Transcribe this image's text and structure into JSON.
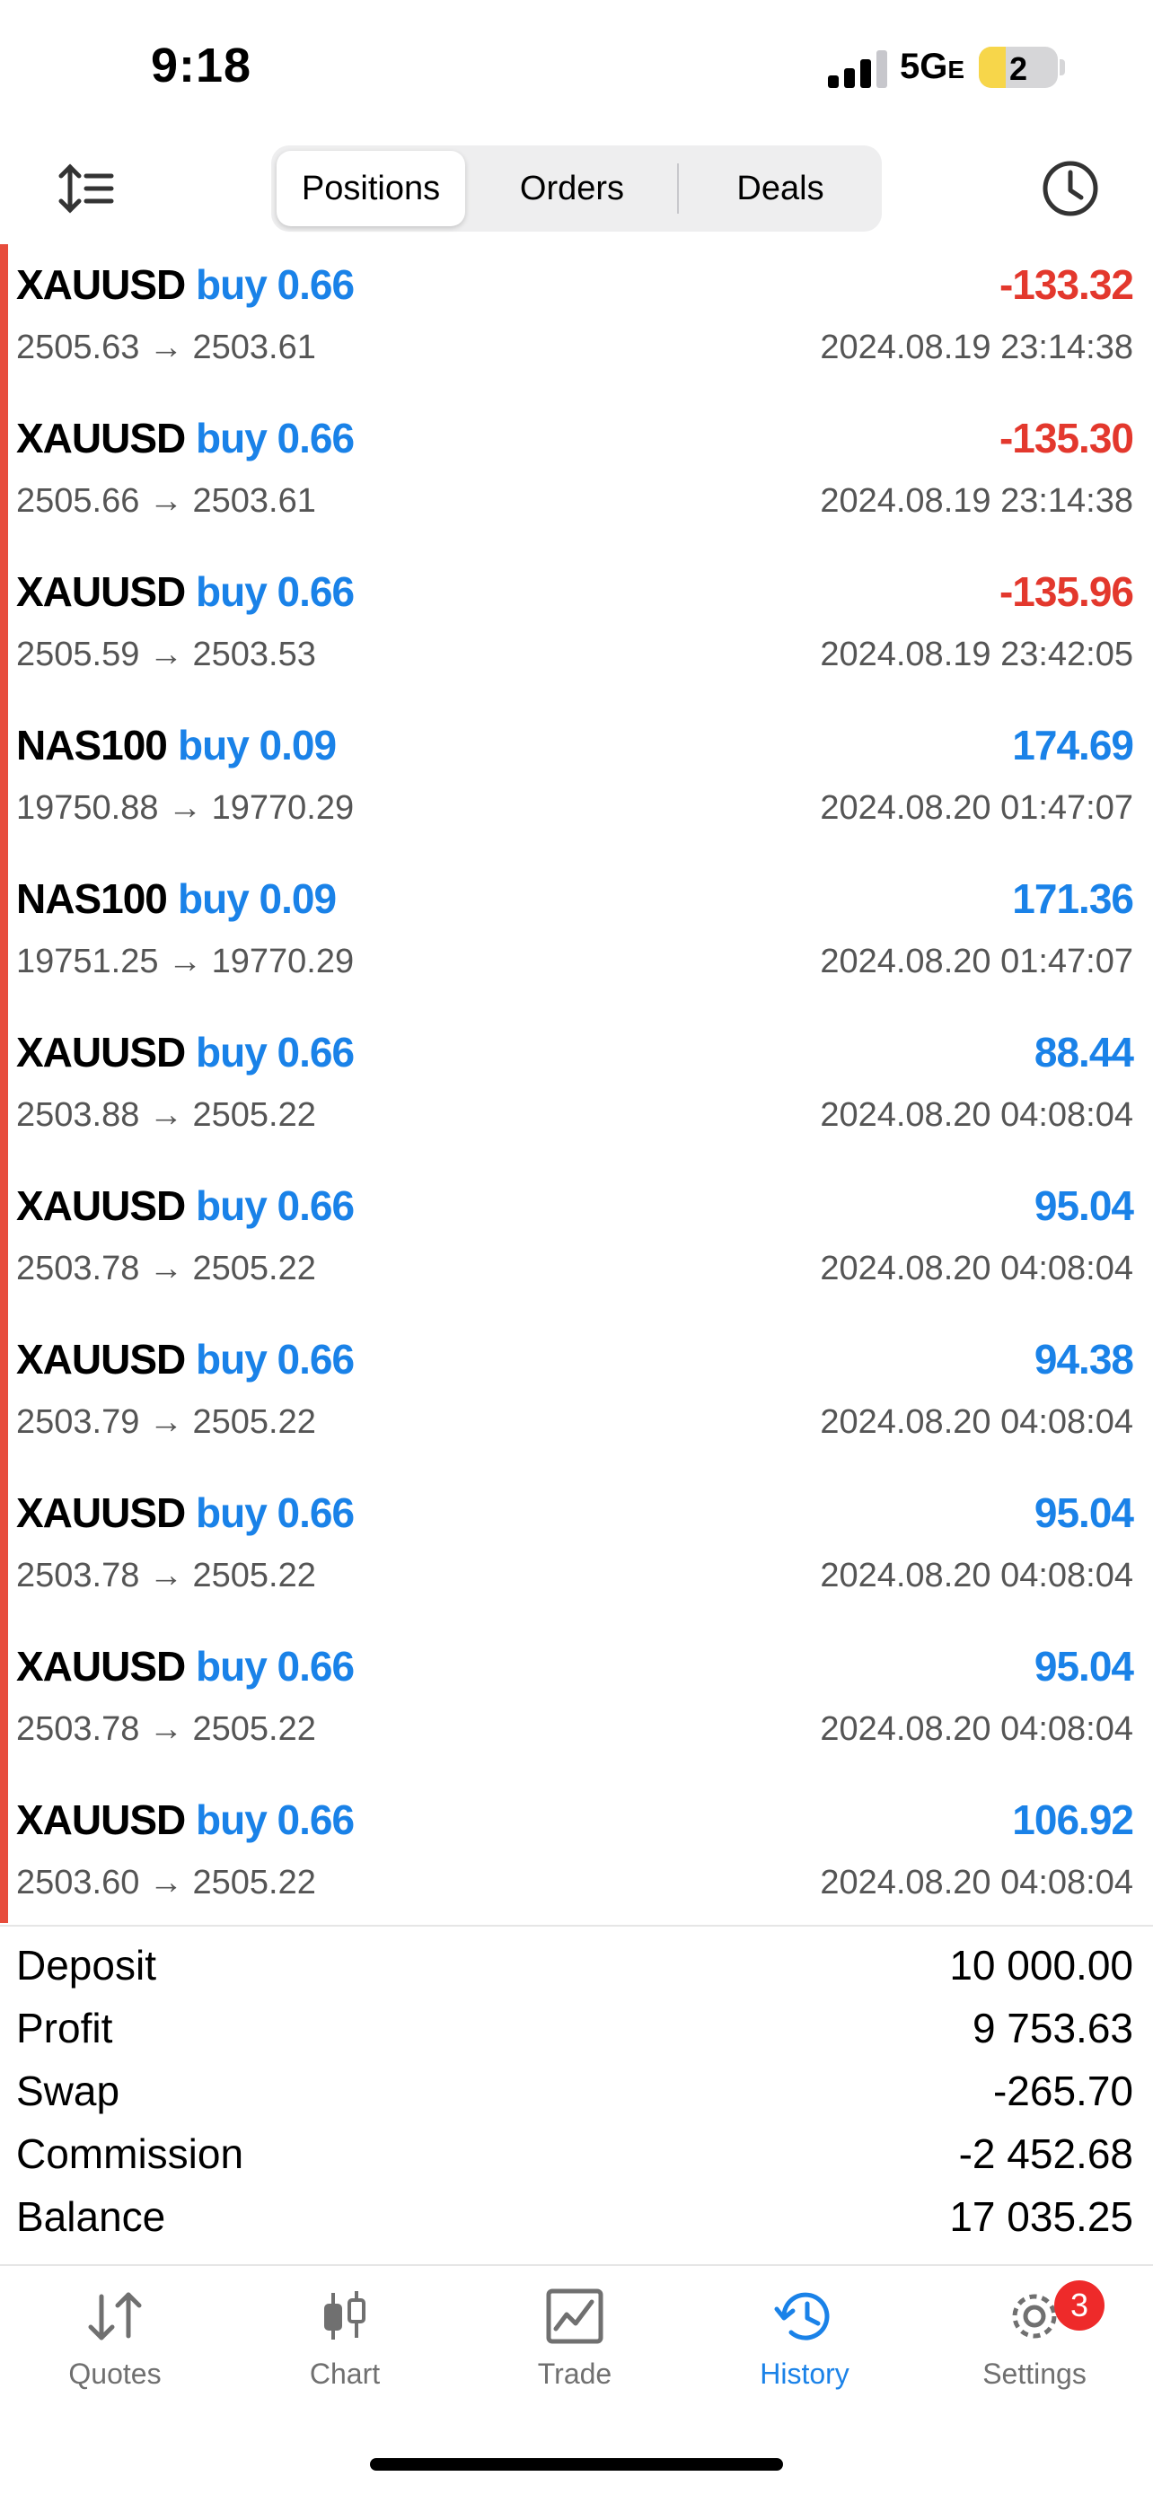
{
  "status_bar": {
    "time": "9:18",
    "network": "5G",
    "network_suffix": "E",
    "battery": "2"
  },
  "toolbar": {
    "tabs": [
      {
        "label": "Positions",
        "active": true
      },
      {
        "label": "Orders",
        "active": false
      },
      {
        "label": "Deals",
        "active": false
      }
    ]
  },
  "positions": [
    {
      "symbol": "XAUUSD",
      "side": "buy 0.66",
      "profit": "-133.32",
      "prices": "2505.63 → 2503.61",
      "time": "2024.08.19 23:14:38",
      "negative": true
    },
    {
      "symbol": "XAUUSD",
      "side": "buy 0.66",
      "profit": "-135.30",
      "prices": "2505.66 → 2503.61",
      "time": "2024.08.19 23:14:38",
      "negative": true
    },
    {
      "symbol": "XAUUSD",
      "side": "buy 0.66",
      "profit": "-135.96",
      "prices": "2505.59 → 2503.53",
      "time": "2024.08.19 23:42:05",
      "negative": true
    },
    {
      "symbol": "NAS100",
      "side": "buy 0.09",
      "profit": "174.69",
      "prices": "19750.88 → 19770.29",
      "time": "2024.08.20 01:47:07",
      "negative": false
    },
    {
      "symbol": "NAS100",
      "side": "buy 0.09",
      "profit": "171.36",
      "prices": "19751.25 → 19770.29",
      "time": "2024.08.20 01:47:07",
      "negative": false
    },
    {
      "symbol": "XAUUSD",
      "side": "buy 0.66",
      "profit": "88.44",
      "prices": "2503.88 → 2505.22",
      "time": "2024.08.20 04:08:04",
      "negative": false
    },
    {
      "symbol": "XAUUSD",
      "side": "buy 0.66",
      "profit": "95.04",
      "prices": "2503.78 → 2505.22",
      "time": "2024.08.20 04:08:04",
      "negative": false
    },
    {
      "symbol": "XAUUSD",
      "side": "buy 0.66",
      "profit": "94.38",
      "prices": "2503.79 → 2505.22",
      "time": "2024.08.20 04:08:04",
      "negative": false
    },
    {
      "symbol": "XAUUSD",
      "side": "buy 0.66",
      "profit": "95.04",
      "prices": "2503.78 → 2505.22",
      "time": "2024.08.20 04:08:04",
      "negative": false
    },
    {
      "symbol": "XAUUSD",
      "side": "buy 0.66",
      "profit": "95.04",
      "prices": "2503.78 → 2505.22",
      "time": "2024.08.20 04:08:04",
      "negative": false
    },
    {
      "symbol": "XAUUSD",
      "side": "buy 0.66",
      "profit": "106.92",
      "prices": "2503.60 → 2505.22",
      "time": "2024.08.20 04:08:04",
      "negative": false
    }
  ],
  "summary": [
    {
      "label": "Deposit",
      "value": "10 000.00"
    },
    {
      "label": "Profit",
      "value": "9 753.63"
    },
    {
      "label": "Swap",
      "value": "-265.70"
    },
    {
      "label": "Commission",
      "value": "-2 452.68"
    },
    {
      "label": "Balance",
      "value": "17 035.25"
    }
  ],
  "tabbar": {
    "items": [
      {
        "label": "Quotes",
        "icon": "quotes-arrows-icon",
        "active": false
      },
      {
        "label": "Chart",
        "icon": "candlestick-icon",
        "active": false
      },
      {
        "label": "Trade",
        "icon": "trade-chart-icon",
        "active": false
      },
      {
        "label": "History",
        "icon": "history-clock-icon",
        "active": true
      },
      {
        "label": "Settings",
        "icon": "gear-icon",
        "active": false
      }
    ],
    "settings_badge": "3"
  },
  "colors": {
    "accent_blue": "#1a82e8",
    "loss_red": "#e3382d",
    "indicator_bar": "#e74c3c",
    "badge_red": "#ee2a2a"
  }
}
